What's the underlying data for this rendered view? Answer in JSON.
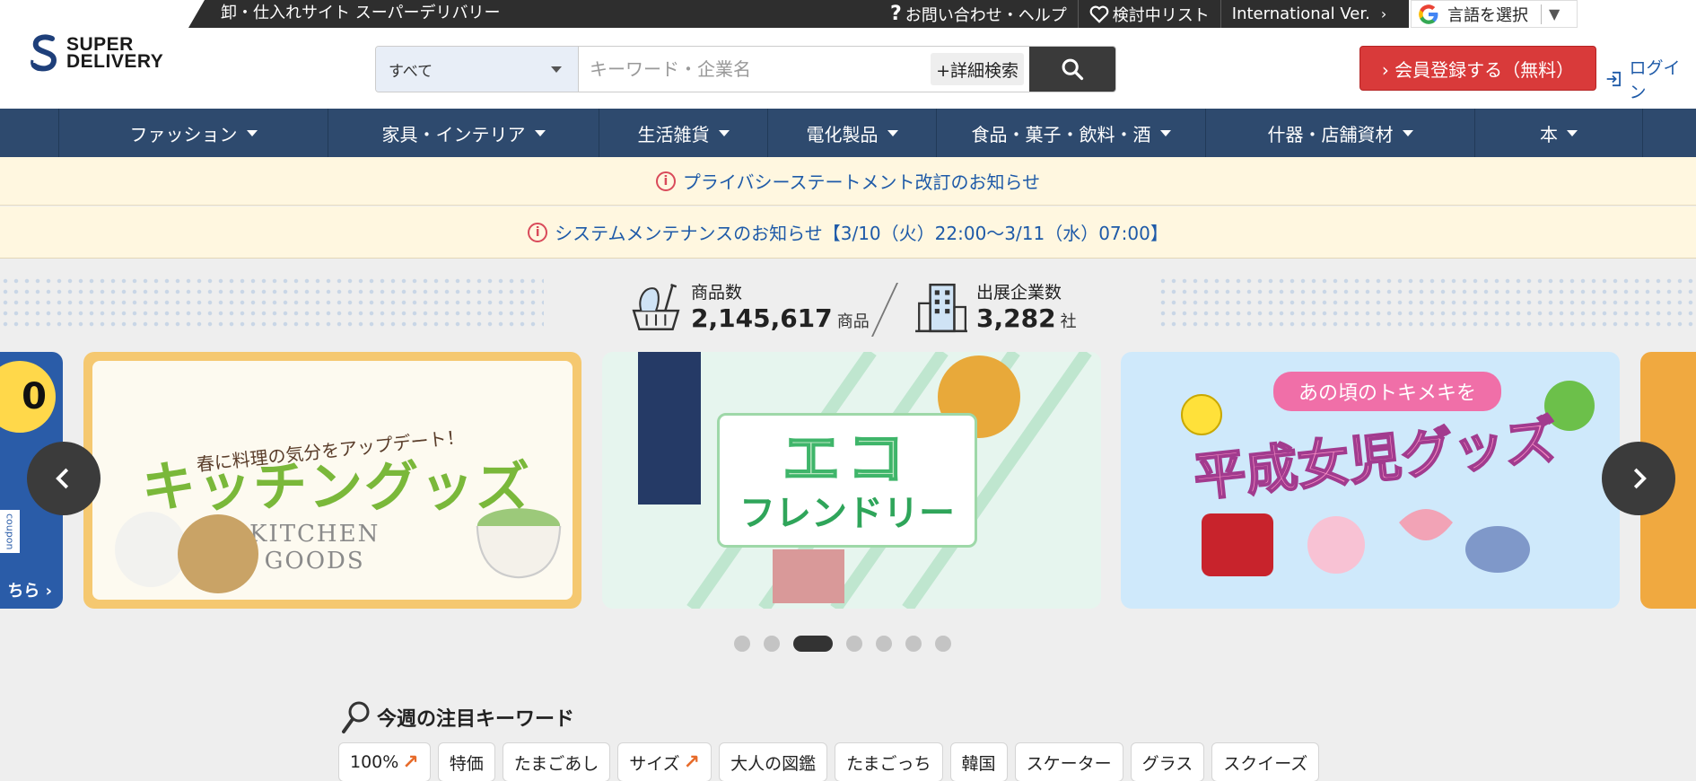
{
  "topbar": {
    "title": "卸・仕入れサイト スーパーデリバリー",
    "contact": "お問い合わせ・ヘルプ",
    "wishlist": "検討中リスト",
    "international": "International Ver.",
    "language": "言語を選択"
  },
  "header": {
    "logo_line1": "SUPER",
    "logo_line2": "DELIVERY",
    "search_category": "すべて",
    "search_placeholder": "キーワード・企業名",
    "advanced_search": "+詳細検索",
    "register": "› 会員登録する（無料）",
    "login": "ログイン"
  },
  "categories": [
    {
      "label": "ファッション"
    },
    {
      "label": "家具・インテリア"
    },
    {
      "label": "生活雑貨"
    },
    {
      "label": "電化製品"
    },
    {
      "label": "食品・菓子・飲料・酒"
    },
    {
      "label": "什器・店舗資材"
    },
    {
      "label": "本"
    }
  ],
  "notices": {
    "privacy": "プライバシーステートメント改訂のお知らせ",
    "maintenance": "システムメンテナンスのお知らせ【3/10（火）22:00〜3/11（水）07:00】"
  },
  "stats": {
    "products_label": "商品数",
    "products_value": "2,145,617",
    "products_unit": "商品",
    "companies_label": "出展企業数",
    "companies_value": "3,282",
    "companies_unit": "社"
  },
  "carousel": {
    "left_partial_price": "0",
    "left_partial_coupon": "coupon",
    "left_partial_more": "ちら ›",
    "slide1_sub": "春に料理の気分をアップデート！",
    "slide1_title": "キッチングッズ",
    "slide1_en1": "KITCHEN",
    "slide1_en2": "GOODS",
    "slide2_line1": "エコ",
    "slide2_line2": "フレンドリー",
    "slide3_top": "あの頃のトキメキを",
    "slide3_title": "平成女児グッズ",
    "dot_count": 7,
    "active_dot": 3
  },
  "keywords": {
    "title": "今週の注目キーワード",
    "items": [
      {
        "label": "100%",
        "trend": "↗"
      },
      {
        "label": "特価",
        "trend": ""
      },
      {
        "label": "たまごあし",
        "trend": ""
      },
      {
        "label": "サイズ",
        "trend": "↗"
      },
      {
        "label": "大人の図鑑",
        "trend": ""
      },
      {
        "label": "たまごっち",
        "trend": ""
      },
      {
        "label": "韓国",
        "trend": ""
      },
      {
        "label": "スケーター",
        "trend": ""
      },
      {
        "label": "グラス",
        "trend": ""
      },
      {
        "label": "スクイーズ",
        "trend": ""
      }
    ]
  },
  "colors": {
    "nav": "#2e4a6e",
    "register": "#d93a3a",
    "link": "#1e5aa8",
    "notice_bg": "#fff7e0"
  }
}
